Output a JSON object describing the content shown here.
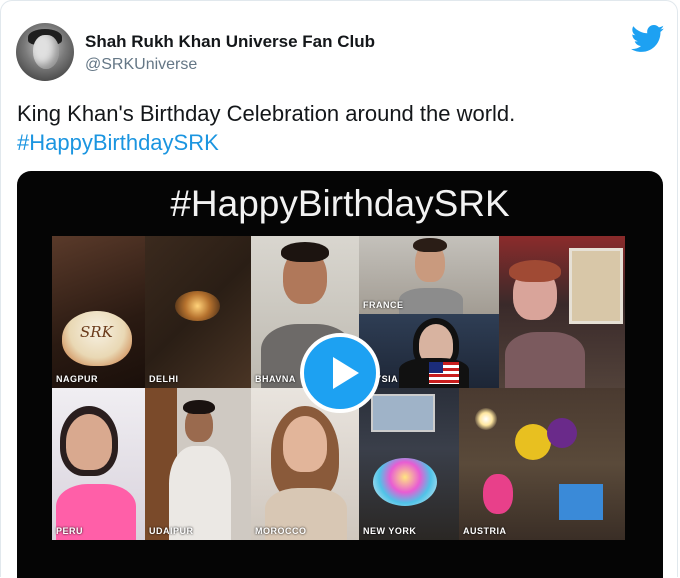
{
  "author": {
    "name": "Shah Rukh Khan Universe Fan Club",
    "handle": "@SRKUniverse"
  },
  "tweet": {
    "text": "King Khan's Birthday Celebration around the world.",
    "hashtag": "#HappyBirthdaySRK"
  },
  "video": {
    "title": "#HappyBirthdaySRK",
    "tiles": [
      {
        "label": "NAGPUR"
      },
      {
        "label": "DELHI"
      },
      {
        "label": "BHAVNA"
      },
      {
        "label": "FRANCE"
      },
      {
        "label": "LAYSIA"
      },
      {
        "label": ""
      },
      {
        "label": "PERU"
      },
      {
        "label": "UDAIPUR"
      },
      {
        "label": "MOROCCO"
      },
      {
        "label": "NEW YORK"
      },
      {
        "label": "AUSTRIA"
      }
    ],
    "cake_text": "SRK"
  },
  "icons": {
    "brand": "twitter-bird-icon",
    "play": "play-icon"
  },
  "colors": {
    "twitter_blue": "#1da1f2",
    "hashtag": "#1b95e0",
    "handle_gray": "#657786"
  }
}
